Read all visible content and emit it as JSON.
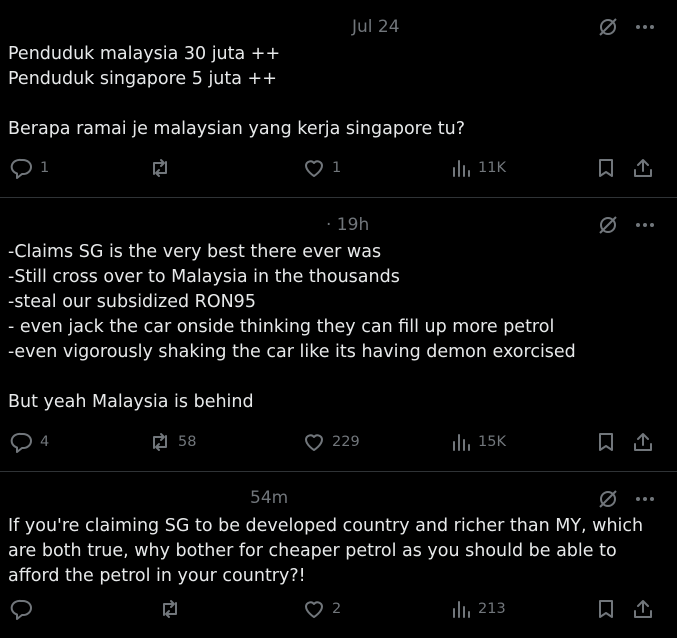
{
  "posts": [
    {
      "time": "Jul 24",
      "text": "Penduduk malaysia 30 juta ++\nPenduduk singapore 5 juta ++\n\nBerapa ramai je malaysian yang kerja singapore tu?",
      "replies": "1",
      "reposts": "",
      "likes": "1",
      "views": "11K"
    },
    {
      "time": "· 19h",
      "text": "-Claims SG is the very best there ever was\n-Still cross over to Malaysia in the thousands\n-steal our subsidized RON95\n- even jack the car onside thinking they can fill up more petrol\n-even vigorously shaking the car like its having demon exorcised\n\nBut yeah Malaysia is behind",
      "replies": "4",
      "reposts": "58",
      "likes": "229",
      "views": "15K"
    },
    {
      "time": "54m",
      "text": "If you're claiming SG to be developed country and richer than MY, which are both true, why bother for cheaper petrol as you should be able to afford the petrol in your country?!",
      "replies": "",
      "reposts": "",
      "likes": "2",
      "views": "213"
    }
  ],
  "icons": {
    "reply": "reply-icon",
    "repost": "repost-icon",
    "like": "heart-icon",
    "views": "views-icon",
    "bookmark": "bookmark-icon",
    "share": "share-icon",
    "grok": "grok-icon",
    "more": "more-icon"
  },
  "colors": {
    "background": "#000000",
    "text": "#e7e9ea",
    "muted": "#71767b",
    "divider": "#2f3336"
  }
}
